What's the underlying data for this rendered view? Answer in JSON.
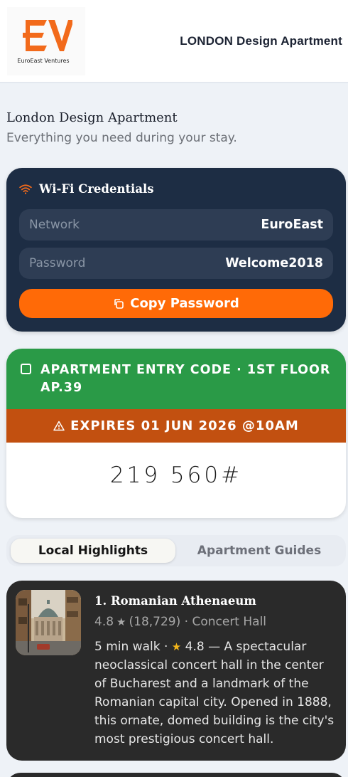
{
  "brand": {
    "logo_text": "EuroEast Ventures",
    "accent": "#f26a1b"
  },
  "header": {
    "title": "LONDON Design Apartment"
  },
  "intro": {
    "title": "London Design Apartment",
    "subtitle": "Everything you need during your stay."
  },
  "wifi": {
    "title": "Wi-Fi Credentials",
    "icon": "wifi-icon",
    "network_label": "Network",
    "network_value": "EuroEast",
    "password_label": "Password",
    "password_value": "Welcome2018",
    "copy_button": "Copy Password",
    "card_color": "#1d2d44",
    "button_color": "#ff6a07"
  },
  "entry": {
    "title": "APARTMENT ENTRY CODE · 1ST FLOOR AP.39",
    "expires": "EXPIRES 01 JUN 2026 @10AM",
    "code": "219 560#",
    "header_color": "#2a9a47",
    "expires_color": "#c25010"
  },
  "tabs": [
    {
      "label": "Local Highlights",
      "active": true
    },
    {
      "label": "Apartment Guides",
      "active": false
    }
  ],
  "places": [
    {
      "title": "1. Romanian Athenaeum",
      "rating": "4.8",
      "reviews": "(18,729)",
      "category": "Concert Hall",
      "walk": "5 min walk · ",
      "desc_rating": "4.8",
      "description": " — A spectacular neoclassical concert hall in the center of Bucharest and a landmark of the Romanian capital city. Opened in 1888, this ornate, domed building is the city's most prestigious concert hall."
    }
  ]
}
